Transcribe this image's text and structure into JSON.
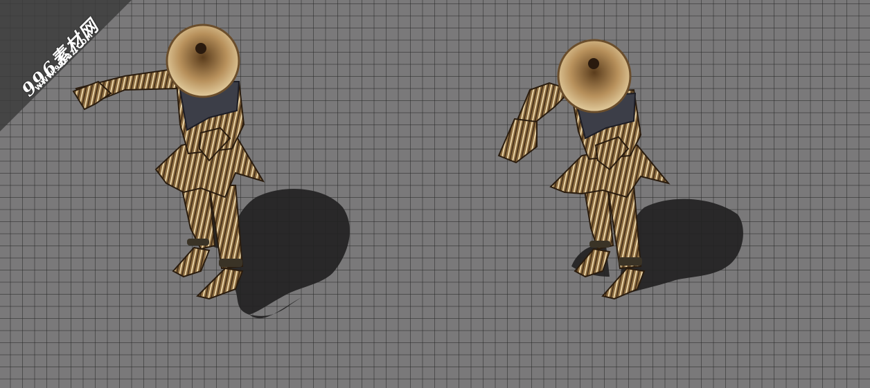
{
  "scene": {
    "grid_color": "#2a2a2a",
    "background_color": "#7a797a"
  },
  "sprites": [
    {
      "name": "straw-creature",
      "shadow_color": "#222222"
    },
    {
      "name": "straw-creature",
      "shadow_color": "#222222"
    }
  ],
  "watermark": {
    "line1": "996素材网",
    "line2": "WWW.996n2.COM",
    "band_color": "#3c3c3c"
  }
}
